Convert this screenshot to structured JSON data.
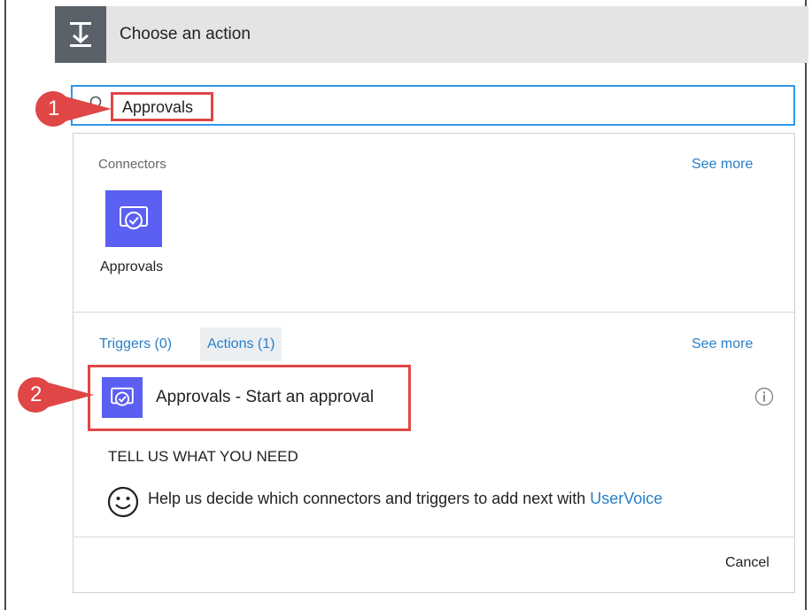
{
  "header": {
    "title": "Choose an action",
    "icon": "flow-step-icon"
  },
  "search": {
    "value": "Approvals",
    "icon": "search-icon"
  },
  "connectors": {
    "label": "Connectors",
    "see_more": "See more",
    "items": [
      {
        "name": "Approvals",
        "icon": "approvals-icon",
        "color": "#5b5ff2"
      }
    ]
  },
  "tabs": [
    {
      "label": "Triggers (0)",
      "active": false
    },
    {
      "label": "Actions (1)",
      "active": true
    }
  ],
  "actions_see_more": "See more",
  "actions": [
    {
      "label": "Approvals - Start an approval",
      "icon": "approvals-icon",
      "info_icon": "info-icon"
    }
  ],
  "feedback": {
    "heading": "TELL US WHAT YOU NEED",
    "text": "Help us decide which connectors and triggers to add next with ",
    "link": "UserVoice",
    "icon": "smiley-icon"
  },
  "footer": {
    "cancel": "Cancel"
  },
  "callouts": [
    {
      "number": "1"
    },
    {
      "number": "2"
    }
  ],
  "colors": {
    "accent": "#2f96e8",
    "connector": "#5b5ff2",
    "callout": "#e04646",
    "link": "#2a7fc9"
  }
}
